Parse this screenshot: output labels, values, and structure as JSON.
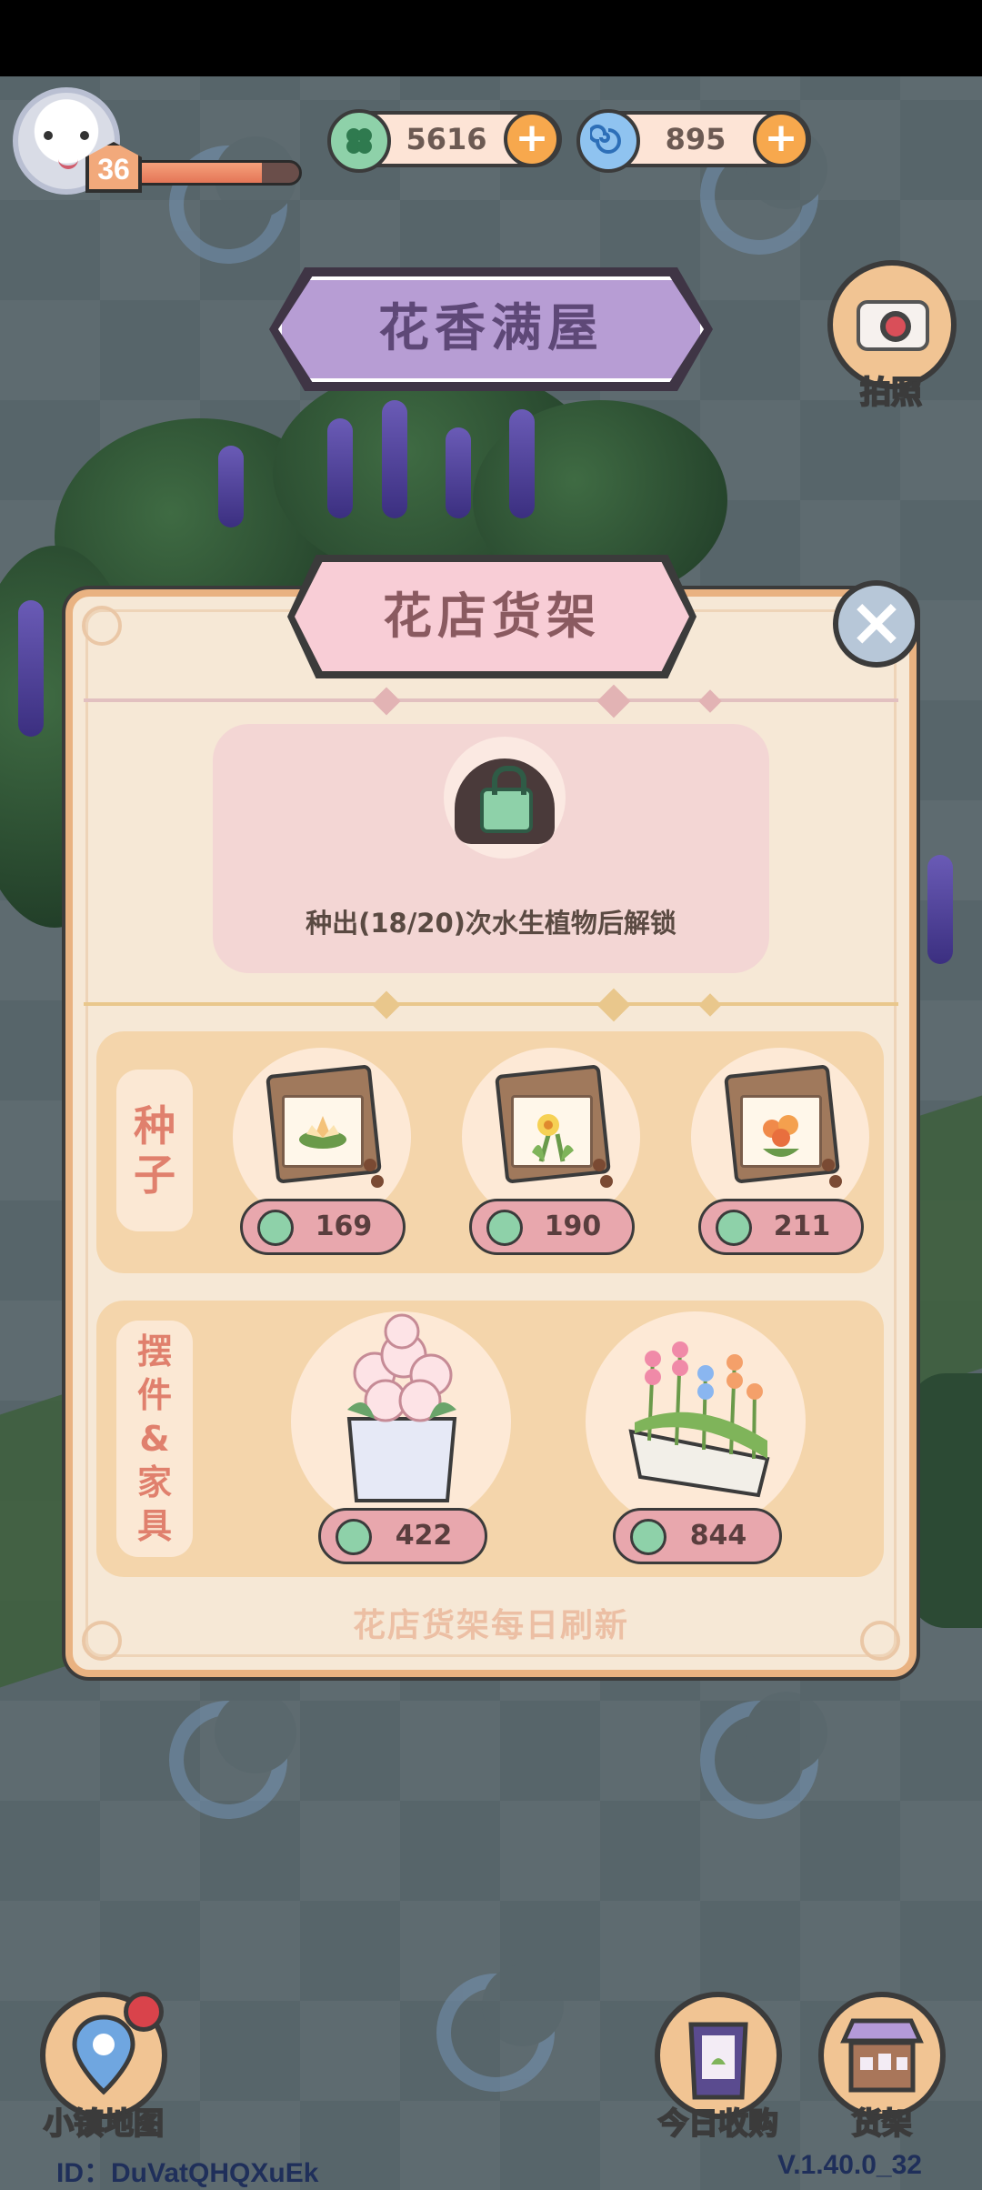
{
  "player": {
    "level": "36",
    "level_progress": 0.78
  },
  "currencies": [
    {
      "name": "clover",
      "icon": "clover-coin-icon",
      "value": "5616",
      "color": "#8ed1a9"
    },
    {
      "name": "swirl",
      "icon": "blue-swirl-icon",
      "value": "895",
      "color": "#5aa0e0"
    }
  ],
  "header": {
    "house_title": "花香满屋",
    "camera_label": "拍照"
  },
  "panel": {
    "title": "花店货架",
    "close_icon": "close-icon",
    "locked": {
      "text": "种出(18/20)次水生植物后解锁"
    },
    "seeds": {
      "label_chars": [
        "种",
        "子"
      ],
      "items": [
        {
          "icon": "water-lily-seed-pack-icon",
          "price": "169"
        },
        {
          "icon": "daffodil-seed-pack-icon",
          "price": "190"
        },
        {
          "icon": "orange-flower-seed-pack-icon",
          "price": "211"
        }
      ]
    },
    "decor": {
      "label_chars": [
        "摆",
        "件",
        "&",
        "家",
        "具"
      ],
      "items": [
        {
          "icon": "pink-hydrangea-pot-icon",
          "price": "422"
        },
        {
          "icon": "flower-planter-box-icon",
          "price": "844"
        }
      ]
    },
    "footer": "花店货架每日刷新"
  },
  "bottom_nav": {
    "map_label": "小镇地图",
    "today_label": "今日收购",
    "shelf_label": "货架",
    "user_id": "ID：DuVatQHQXuEk",
    "version": "V.1.40.0_32"
  },
  "colors": {
    "panel_bg": "#f6e8d6",
    "accent_pink": "#f8cdd6",
    "price_pill": "#e8a7ad",
    "clover_green": "#8ed1a9"
  }
}
